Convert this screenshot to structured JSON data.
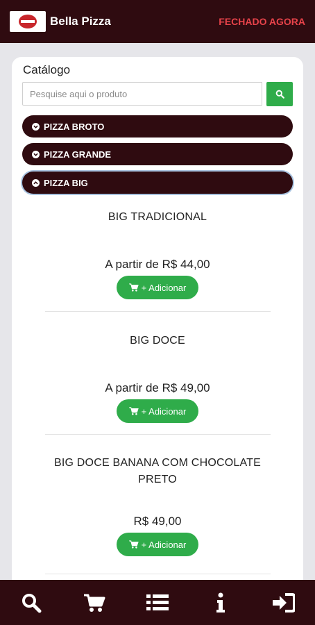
{
  "header": {
    "brand": "Bella Pizza",
    "status": "FECHADO AGORA",
    "status_color": "#e8434a",
    "background": "#2f0b10"
  },
  "catalog": {
    "title": "Catálogo",
    "search_placeholder": "Pesquise aqui o produto",
    "search_icon": "search-icon",
    "categories": [
      {
        "label": "PIZZA BROTO",
        "state": "collapsed",
        "icon": "chevron-down-circle-icon"
      },
      {
        "label": "PIZZA GRANDE",
        "state": "collapsed",
        "icon": "chevron-down-circle-icon"
      },
      {
        "label": "PIZZA BIG",
        "state": "expanded",
        "icon": "chevron-up-circle-icon"
      }
    ],
    "products": [
      {
        "name": "BIG TRADICIONAL",
        "name_line2": "",
        "price": "A partir de R$ 44,00",
        "button": "+ Adicionar"
      },
      {
        "name": "BIG DOCE",
        "name_line2": "",
        "price": "A partir de R$ 49,00",
        "button": "+ Adicionar"
      },
      {
        "name": "BIG DOCE BANANA COM CHOCOLATE",
        "name_line2": "PRETO",
        "price": "R$ 49,00",
        "button": "+ Adicionar"
      }
    ]
  },
  "bottom_nav": {
    "items": [
      "search-icon",
      "cart-icon",
      "list-icon",
      "info-icon",
      "sign-in-icon"
    ]
  },
  "colors": {
    "accent_green": "#2fac4a",
    "dark_maroon": "#2f0b10"
  }
}
